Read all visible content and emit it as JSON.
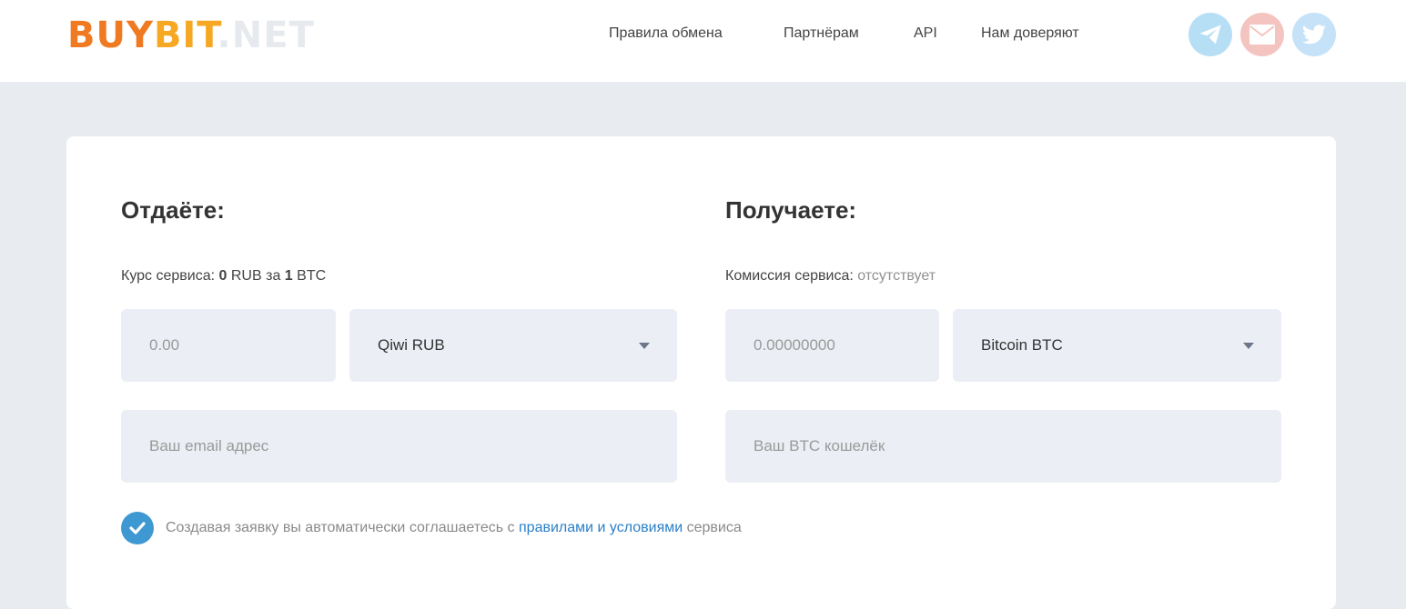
{
  "header": {
    "logo": {
      "part1": "BUY",
      "part2": "BIT",
      "part3": ".NET"
    },
    "nav": [
      "Правила обмена",
      "Партнёрам",
      "API",
      "Нам доверяют"
    ],
    "social": [
      {
        "icon": "telegram-icon",
        "color": "#b6dff5"
      },
      {
        "icon": "mail-icon",
        "color": "#f4c4c0"
      },
      {
        "icon": "twitter-icon",
        "color": "#c5e2f8"
      }
    ]
  },
  "give": {
    "title": "Отдаёте:",
    "rate_label": "Курс сервиса:",
    "rate_from": "0",
    "rate_from_cur": "RUB за",
    "rate_to": "1",
    "rate_to_cur": "BTC",
    "amount_placeholder": "0.00",
    "currency": "Qiwi RUB",
    "email_placeholder": "Ваш email адрес"
  },
  "get": {
    "title": "Получаете:",
    "fee_label": "Комиссия сервиса:",
    "fee_value": "отсутствует",
    "amount_placeholder": "0.00000000",
    "currency": "Bitcoin BTC",
    "wallet_placeholder": "Ваш BTC кошелёк"
  },
  "agreement": {
    "text_before": "Создавая заявку вы автоматически соглашаетесь с",
    "link": "правилами и условиями",
    "text_after": "сервиса"
  }
}
